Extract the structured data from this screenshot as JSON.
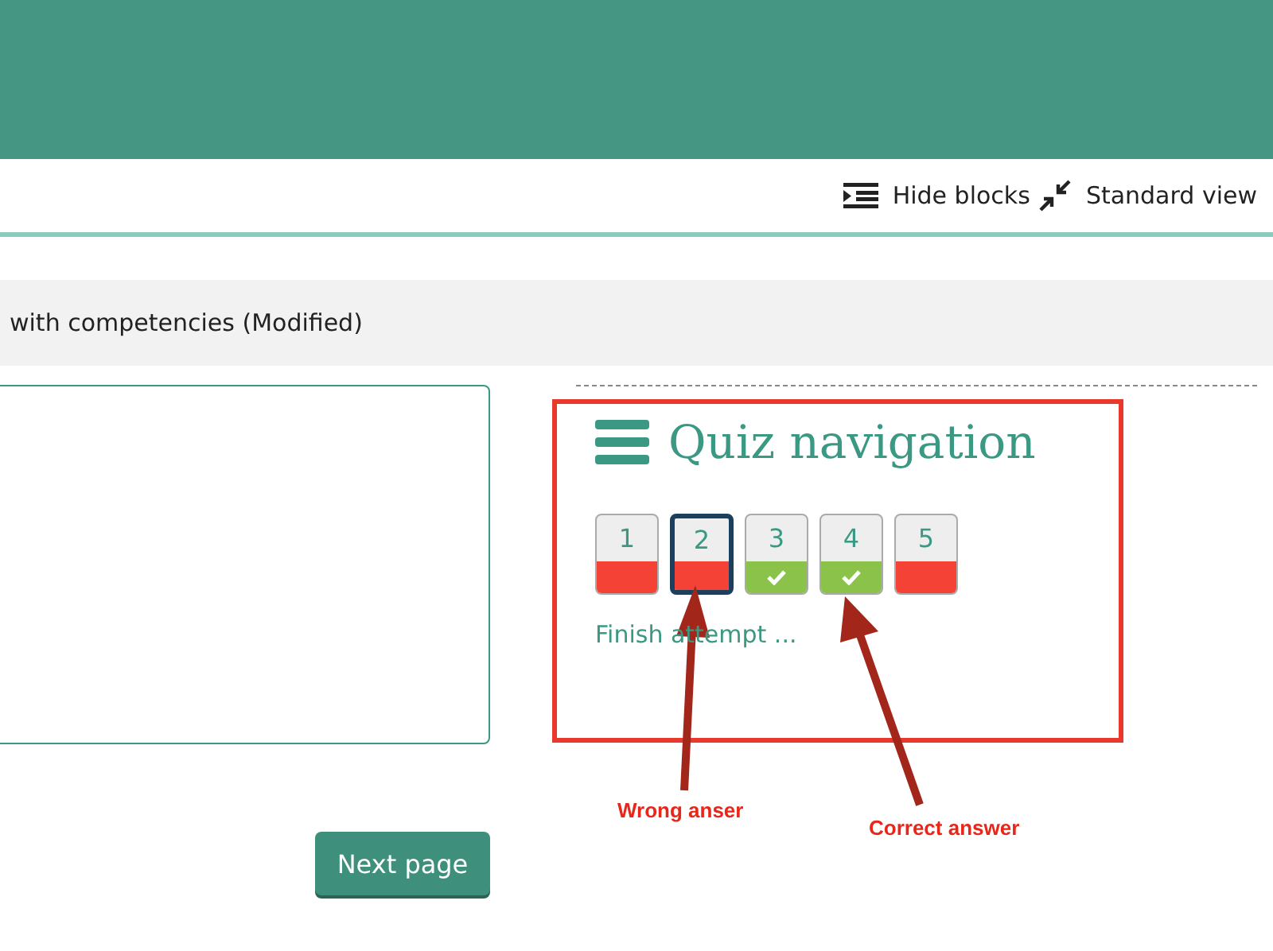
{
  "toolbar": {
    "hide_blocks": "Hide blocks",
    "standard_view": "Standard view"
  },
  "page_heading": "with competencies (Modified)",
  "quiz_navigation": {
    "title": "Quiz navigation",
    "questions": [
      {
        "number": "1",
        "correct": false,
        "selected": false
      },
      {
        "number": "2",
        "correct": false,
        "selected": true
      },
      {
        "number": "3",
        "correct": true,
        "selected": false
      },
      {
        "number": "4",
        "correct": true,
        "selected": false
      },
      {
        "number": "5",
        "correct": false,
        "selected": false
      }
    ],
    "finish_link": "Finish attempt ..."
  },
  "next_button": "Next page",
  "annotations": [
    {
      "label": "Wrong anser"
    },
    {
      "label": "Correct answer"
    }
  ]
}
